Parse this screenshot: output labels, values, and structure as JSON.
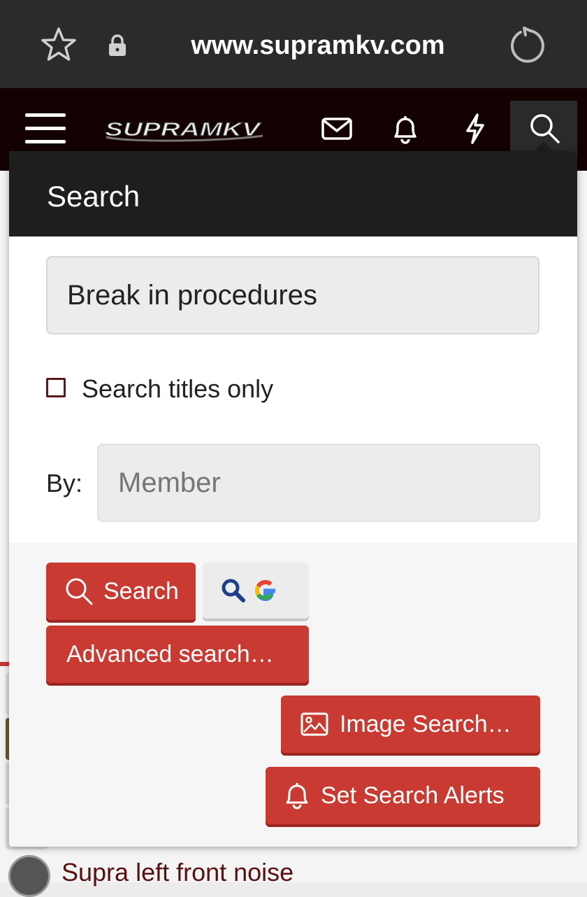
{
  "browser": {
    "url": "www.supramkv.com",
    "icons": [
      "star-icon",
      "lock-icon",
      "reload-icon"
    ]
  },
  "site_header": {
    "logo_text": "SUPRAMKV",
    "icons": [
      "menu-icon",
      "envelope-icon",
      "bell-icon",
      "lightning-icon",
      "search-icon"
    ],
    "colors": {
      "background": "#140202"
    }
  },
  "search_popup": {
    "title": "Search",
    "query_value": "Break in procedures",
    "titles_only_label": "Search titles only",
    "titles_only_checked": false,
    "by_label": "By:",
    "member_placeholder": "Member",
    "search_button_label": "Search",
    "google_button_icon": "google-search-icon",
    "advanced_button_label": "Advanced search…",
    "image_search_label": "Image Search…",
    "alerts_label": "Set Search Alerts",
    "colors": {
      "accent": "#c83a32",
      "header": "#1e1e1e"
    }
  },
  "background_page": {
    "thread_title": "Supra left front noise"
  }
}
